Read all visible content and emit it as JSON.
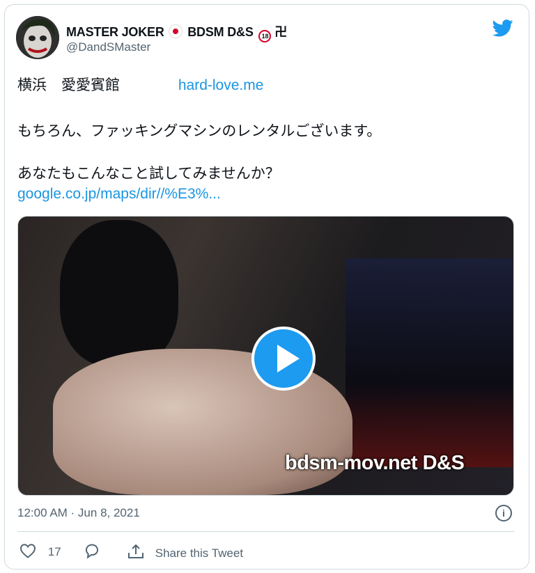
{
  "author": {
    "display_name": "MASTER JOKER",
    "display_name_suffix": "BDSM D&S",
    "badge_18": "18",
    "badge_symbol": "卍",
    "handle": "@DandSMaster"
  },
  "tweet": {
    "line1_text": "横浜　愛愛賓館",
    "line1_link": "hard-love.me",
    "line2": "もちろん、ファッキングマシンのレンタルございます。",
    "line3": "あなたもこんなこと試してみませんか？",
    "line4_link": "google.co.jp/maps/dir//%E3%..."
  },
  "media": {
    "watermark": "bdsm-mov.net D&S"
  },
  "meta": {
    "timestamp": "12:00 AM · Jun 8, 2021",
    "info_glyph": "i"
  },
  "actions": {
    "like_count": "17",
    "share_label": "Share this Tweet"
  },
  "colors": {
    "link": "#1b95e0",
    "twitter_blue": "#1d9bf0",
    "secondary_text": "#536471",
    "border": "#cfd9de"
  }
}
